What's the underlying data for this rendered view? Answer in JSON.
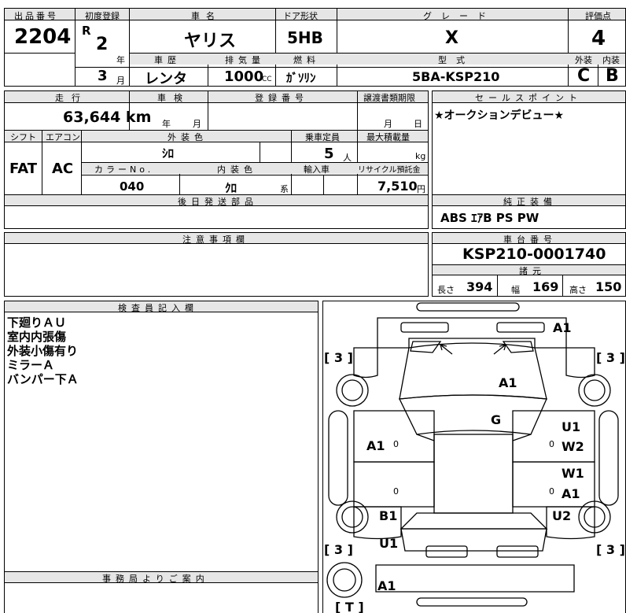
{
  "header": {
    "lot_label": "出品番号",
    "lot_no": "2204",
    "first_reg_label": "初度登録",
    "era": "R",
    "year": "2",
    "year_unit": "年",
    "month": "3",
    "month_unit": "月",
    "name_label": "車名",
    "car_name": "ヤリス",
    "door_label": "ドア形状",
    "door": "5HB",
    "grade_label": "グレード",
    "grade": "X",
    "score_label": "評価点",
    "score": "4",
    "history_label": "車歴",
    "history": "レンタ",
    "displacement_label": "排気量",
    "displacement": "1000",
    "cc": "CC",
    "fuel_label": "燃料",
    "fuel": "ｶﾞｿﾘﾝ",
    "model_label": "型式",
    "model": "5BA-KSP210",
    "exterior_grade_label": "外装",
    "exterior_grade": "C",
    "interior_grade_label": "内装",
    "interior_grade": "B"
  },
  "spec": {
    "mileage_label": "走行",
    "mileage": "63,644 km",
    "inspection_label": "車検",
    "inspection_year": "年",
    "inspection_month": "月",
    "registration_label": "登録番号",
    "transfer_label": "譲渡書類期限",
    "transfer_month": "月",
    "transfer_day": "日",
    "shift_label": "シフト",
    "shift": "FAT",
    "aircon_label": "エアコン",
    "aircon": "AC",
    "exterior_color_label": "外装色",
    "exterior_color": "ｼﾛ",
    "capacity_label": "乗車定員",
    "capacity": "5",
    "capacity_unit": "人",
    "max_load_label": "最大積載量",
    "max_load_unit": "kg",
    "color_no_label": "カラーNo.",
    "color_no": "040",
    "interior_color_label": "内装色",
    "interior_color": "ｸﾛ",
    "interior_color_suffix": "系",
    "import_label": "輸入車",
    "recycle_label": "リサイクル預託金",
    "recycle": "7,510",
    "recycle_unit": "円",
    "later_parts_label": "後日発送部品"
  },
  "sales": {
    "label": "セールスポイント",
    "text": "★オークションデビュー★",
    "equipment_label": "純正装備",
    "equipment": "ABS ｴｱB PS PW"
  },
  "caution": {
    "label": "注意事項欄"
  },
  "chassis": {
    "label": "車台番号",
    "number": "KSP210-0001740",
    "dims_label": "諸元",
    "length_label": "長さ",
    "length": "394",
    "width_label": "幅",
    "width": "169",
    "height_label": "高さ",
    "height": "150"
  },
  "inspector": {
    "label": "検査員記入欄",
    "notes": [
      "下廻りＡＵ",
      "室内内張傷",
      "外装小傷有り",
      "ミラーＡ",
      "バンパー下Ａ"
    ]
  },
  "office": {
    "label": "事務局よりご案内"
  },
  "diagram": {
    "tires": [
      "[ 3 ]",
      "[ 3 ]",
      "[ 3 ]",
      "[ 3 ]"
    ],
    "spare": "[ T ]",
    "marks": {
      "front_bumper": "A1",
      "hood": "A1",
      "windshield": "G",
      "left_front_door": "A1",
      "right_front_door_top": "U1",
      "right_front_door_bottom": "W2",
      "right_rear_door_top": "W1",
      "right_rear_door_bottom": "A1",
      "left_rear_fender": "B1",
      "left_rocker": "U1",
      "right_rear_fender": "U2",
      "rear_bumper": "A1"
    },
    "zero_mark": "0"
  }
}
